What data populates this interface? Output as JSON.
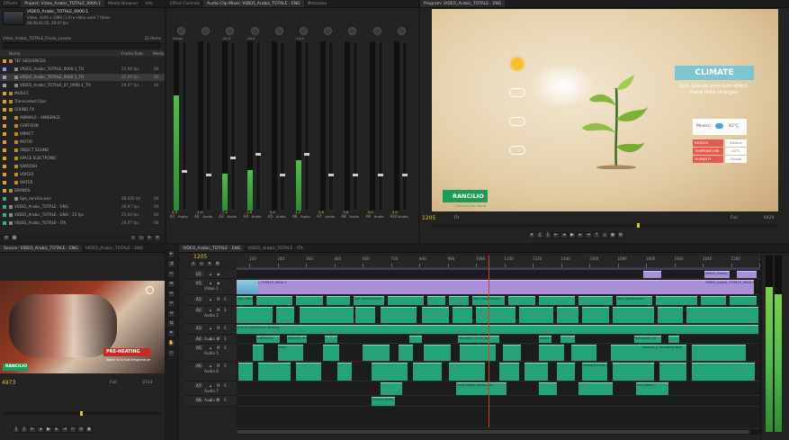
{
  "colors": {
    "video_clip": "#a98ed8",
    "audio_clip": "#2bb78a",
    "playhead": "#e0352b",
    "timecode": "#e8c02a",
    "meter_green": "#4fbf4a"
  },
  "project": {
    "tabs": [
      "Effects",
      "Project: Video_Arabic_TOTALE_0000.1",
      "Media Browser",
      "Info"
    ],
    "clip_name": "VIDEO_Arabic_TOTALE_0000.1",
    "clip_info": "Video, 1920 x 1080 (1.0)  ▾  video used 7 times",
    "clip_info2": "00;00;41;05, 29.97 fps",
    "bin_path": "Video_Arabic_TOTALE_Finale_Lavoro",
    "item_count": "21 Items",
    "columns": {
      "name": "Name",
      "frame_rate": "Frame Rate",
      "media": "Media"
    },
    "items": [
      {
        "name": "TEF SEQUENCES",
        "rate": "",
        "media": "",
        "color": "#e0a020",
        "indent": 1,
        "type": "folder"
      },
      {
        "name": "VIDEO_Arabic_TOTALE_0000.1_TO",
        "rate": "25,00 fps",
        "media": "00",
        "color": "#a98ed8",
        "indent": 2,
        "type": "seq"
      },
      {
        "name": "VIDEO_Arabic_TOTALE_0000.1_TO",
        "rate": "25,00 fps",
        "media": "00",
        "color": "#a98ed8",
        "indent": 2,
        "type": "seq"
      },
      {
        "name": "VIDEO_Arabic_TOTALE_07_0000.1_TO",
        "rate": "29,97 fps",
        "media": "00",
        "color": "#a98ed8",
        "indent": 2,
        "type": "seq"
      },
      {
        "name": "MUSICC",
        "rate": "",
        "media": "",
        "color": "#e0a020",
        "indent": 1,
        "type": "folder"
      },
      {
        "name": "Transcoded Clips",
        "rate": "",
        "media": "",
        "color": "#e0a020",
        "indent": 1,
        "type": "folder"
      },
      {
        "name": "SOUND FX",
        "rate": "",
        "media": "",
        "color": "#e0a020",
        "indent": 1,
        "type": "folder"
      },
      {
        "name": "ANIMALS - AMBIENCE",
        "rate": "",
        "media": "",
        "color": "#e0a020",
        "indent": 2,
        "type": "folder"
      },
      {
        "name": "CARTOON",
        "rate": "",
        "media": "",
        "color": "#e0a020",
        "indent": 2,
        "type": "folder"
      },
      {
        "name": "IMPACT",
        "rate": "",
        "media": "",
        "color": "#e0a020",
        "indent": 2,
        "type": "folder"
      },
      {
        "name": "MOTIO",
        "rate": "",
        "media": "",
        "color": "#e0a020",
        "indent": 2,
        "type": "folder"
      },
      {
        "name": "OBJECT SOUND",
        "rate": "",
        "media": "",
        "color": "#e0a020",
        "indent": 2,
        "type": "folder"
      },
      {
        "name": "SPACE ELECTRONIC",
        "rate": "",
        "media": "",
        "color": "#e0a020",
        "indent": 2,
        "type": "folder"
      },
      {
        "name": "SWOOSH",
        "rate": "",
        "media": "",
        "color": "#e0a020",
        "indent": 2,
        "type": "folder"
      },
      {
        "name": "VOICES",
        "rate": "",
        "media": "",
        "color": "#e0a020",
        "indent": 2,
        "type": "folder"
      },
      {
        "name": "WATER",
        "rate": "",
        "media": "",
        "color": "#e0a020",
        "indent": 2,
        "type": "folder"
      },
      {
        "name": "BRANDS",
        "rate": "",
        "media": "",
        "color": "#e0a020",
        "indent": 1,
        "type": "folder"
      },
      {
        "name": "Spk_rancilio.wav",
        "rate": "48.000 Hz",
        "media": "00",
        "color": "#2bb78a",
        "indent": 2,
        "type": "audio"
      },
      {
        "name": "VIDEO_Arabic_TOTALE - ENG",
        "rate": "29,97 fps",
        "media": "00",
        "color": "#2bb78a",
        "indent": 1,
        "type": "seq"
      },
      {
        "name": "VIDEO_Arabic_TOTALE - ENG - 25 fps",
        "rate": "25,00 fps",
        "media": "00",
        "color": "#2bb78a",
        "indent": 1,
        "type": "seq"
      },
      {
        "name": "VIDEO_Arabic_TOTALE - ITA",
        "rate": "29,97 fps",
        "media": "00",
        "color": "#2bb78a",
        "indent": 1,
        "type": "seq"
      }
    ]
  },
  "mixer": {
    "tabs": [
      "Effect Controls",
      "Audio Clip Mixer: VIDEO_Arabic_TOTALE - ENG",
      "Metadata"
    ],
    "channels": [
      {
        "top": "Drops",
        "label": "A1",
        "knob": "0,0",
        "level": 0.68,
        "fader": 0.22,
        "val": "0,0",
        "r": "R"
      },
      {
        "top": "",
        "label": "A2",
        "knob": "",
        "level": 0.0,
        "fader": 0.2,
        "val": "-1,0",
        "r": "R"
      },
      {
        "top": "-10,0",
        "label": "A3",
        "knob": "",
        "level": 0.22,
        "fader": 0.3,
        "val": "-7,4",
        "r": "R"
      },
      {
        "top": "-18,0",
        "label": "A4",
        "knob": "",
        "level": 0.24,
        "fader": 0.32,
        "val": "-1,8",
        "r": "R"
      },
      {
        "top": "",
        "label": "A5",
        "knob": "",
        "level": 0.0,
        "fader": 0.2,
        "val": "0,0",
        "r": "R"
      },
      {
        "top": "-14,0",
        "label": "A6",
        "knob": "",
        "level": 0.3,
        "fader": 0.32,
        "val": "-1,4",
        "r": "R"
      },
      {
        "top": "",
        "label": "A7",
        "knob": "",
        "level": 0.0,
        "fader": 0.2,
        "val": "0,0",
        "r": "R"
      },
      {
        "top": "",
        "label": "A8",
        "knob": "",
        "level": 0.0,
        "fader": 0.2,
        "val": "0,0",
        "r": "R"
      },
      {
        "top": "",
        "label": "A9",
        "knob": "",
        "level": 0.0,
        "fader": 0.2,
        "val": "0,0",
        "r": "R"
      },
      {
        "top": "",
        "label": "A10",
        "knob": "",
        "level": 0.0,
        "fader": 0.2,
        "val": "0,0",
        "r": "R"
      }
    ],
    "audio_label": "Audio"
  },
  "program": {
    "tab": "Program: VIDEO_Arabic_TOTALE - ENG",
    "title": "CLIMATE",
    "subtitle": "Sun, clouds and river affect these little changes",
    "city": "Mexico",
    "temp": "42°C",
    "rows": [
      {
        "k": "REGION",
        "v": "Mexico"
      },
      {
        "k": "TEMPERATURE",
        "v": "42°C"
      },
      {
        "k": "HUMIDITY",
        "v": "Clouds"
      }
    ],
    "brand": "RANCILIO",
    "brand_tag": "Caffeing the World",
    "timecode": "1205",
    "zoom": "Fit",
    "res": "Full",
    "duration": "6420"
  },
  "source": {
    "tabs": [
      "Source: VIDEO_Arabic_TOTALE - ENG",
      "VIDEO_Arabic_TOTALE - ENG"
    ],
    "caption": "PRE-HEATING",
    "caption2": "Water at $ fold temperature",
    "brand": "RANCILIO",
    "timecode": "4973",
    "zoom": "Full",
    "duration": "3733"
  },
  "timeline": {
    "tabs": [
      "VIDEO_Arabic_TOTALE - ENG",
      "VIDEO_Arabic_TOTALE - ITA"
    ],
    "timecode": "1205",
    "ruler": [
      "120",
      "240",
      "360",
      "480",
      "600",
      "720",
      "840",
      "960",
      "1080",
      "1200",
      "1320",
      "1440",
      "1560",
      "1680",
      "1800",
      "1920",
      "2040",
      "2160",
      "2280",
      "2400"
    ],
    "tracks": [
      {
        "id": "V2",
        "name": "",
        "h": 10
      },
      {
        "id": "V1",
        "name": "Video 1",
        "h": 18
      },
      {
        "id": "A1",
        "name": "",
        "h": 12
      },
      {
        "id": "A2",
        "name": "Audio 2",
        "h": 20
      },
      {
        "id": "A3",
        "name": "",
        "h": 12
      },
      {
        "id": "A4",
        "name": "Audio 4",
        "h": 10
      },
      {
        "id": "A5",
        "name": "Audio 5",
        "h": 20
      },
      {
        "id": "A6",
        "name": "Audio 6",
        "h": 22
      },
      {
        "id": "A7",
        "name": "Audio 7",
        "h": 16
      },
      {
        "id": "A8",
        "name": "Audio 8",
        "h": 12
      }
    ],
    "clip_labels": {
      "v": "VIDEO_Arabic_TOTALE_0000.1",
      "a": "Spk_rancilio.wav",
      "cartoon": "CARTOON",
      "mphone": "Mysteric Tra",
      "thunder": "Thunder1 Strid_Ice",
      "cubes": "Ice Cubes_m",
      "boss": "Boss",
      "swoosh": "Swoosh_1 Shooting Wire",
      "camera": "Camera noise [03]",
      "cubes2": "Ice Cubes 7",
      "crunch": "Crunch Inner",
      "long": "Long water wacky.wav",
      "loop": "Loop_frame",
      "water": "water",
      "slide": "Slide Horn",
      "fb": "Eric (4) Electronic Whoosh",
      "apex": "Apex B Beeps"
    }
  }
}
